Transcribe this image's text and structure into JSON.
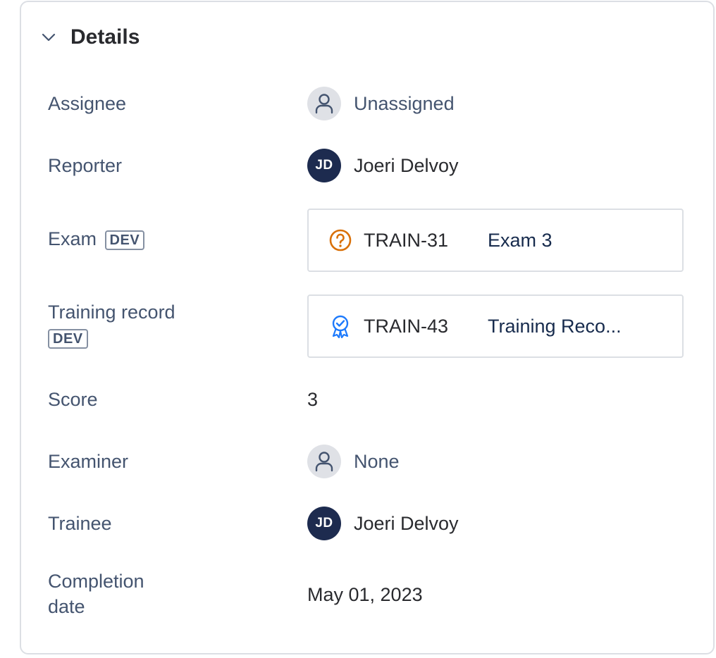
{
  "section": {
    "title": "Details"
  },
  "fields": {
    "assignee": {
      "label": "Assignee",
      "value": "Unassigned"
    },
    "reporter": {
      "label": "Reporter",
      "value": "Joeri Delvoy",
      "initials": "JD"
    },
    "exam": {
      "label": "Exam",
      "badge": "DEV",
      "key": "TRAIN-31",
      "summary": "Exam 3",
      "icon": "question-circle-icon",
      "icon_color": "#d97008"
    },
    "training_record": {
      "label": "Training record",
      "badge": "DEV",
      "key": "TRAIN-43",
      "summary": "Training Reco...",
      "icon": "award-badge-icon",
      "icon_color": "#1d7afc"
    },
    "score": {
      "label": "Score",
      "value": "3"
    },
    "examiner": {
      "label": "Examiner",
      "value": "None"
    },
    "trainee": {
      "label": "Trainee",
      "value": "Joeri Delvoy",
      "initials": "JD"
    },
    "completion_date": {
      "label_line1": "Completion",
      "label_line2": "date",
      "value": "May 01, 2023"
    }
  },
  "colors": {
    "avatar_bg": "#1d2b4f",
    "border": "#dcdfe4",
    "label": "#44546f"
  }
}
